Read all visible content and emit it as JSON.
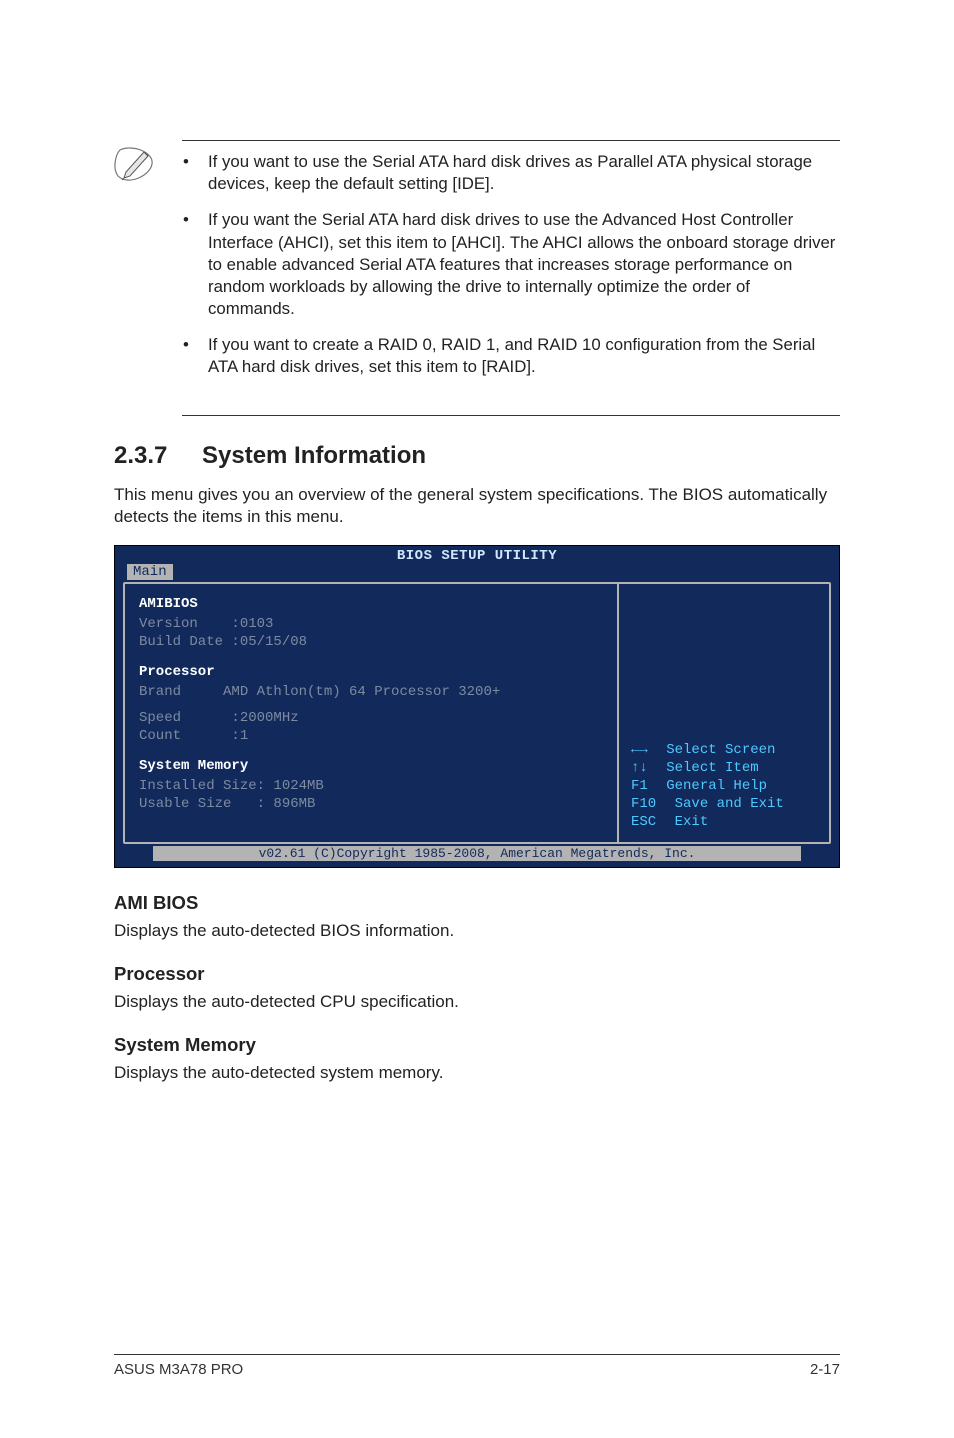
{
  "note": {
    "bullets": [
      "If you want to use the Serial ATA hard disk drives as Parallel ATA physical storage devices, keep the default setting [IDE].",
      "If you want the Serial ATA hard disk drives to use the Advanced Host Controller Interface (AHCI), set this item to [AHCI]. The AHCI allows the onboard storage driver to enable advanced Serial ATA features that increases storage performance on random workloads by allowing the drive to internally optimize the order of commands.",
      "If you want to create a RAID 0, RAID 1, and RAID 10 configuration from the Serial ATA hard disk drives, set this item to [RAID]."
    ]
  },
  "section": {
    "number": "2.3.7",
    "title": "System Information",
    "intro": "This menu gives you an overview of the general system specifications. The BIOS automatically detects the items in this menu."
  },
  "bios": {
    "title": "BIOS SETUP UTILITY",
    "tab": "Main",
    "left": {
      "h1": "AMIBIOS",
      "r1": "Version    :0103",
      "r2": "Build Date :05/15/08",
      "h2": "Processor",
      "r3": "Brand     AMD Athlon(tm) 64 Processor 3200+",
      "r4": "Speed      :2000MHz",
      "r5": "Count      :1",
      "h3": "System Memory",
      "r6": "Installed Size: 1024MB",
      "r7": "Usable Size   : 896MB"
    },
    "help": {
      "l1k": "←→",
      "l1v": " Select Screen",
      "l2k": "↑↓",
      "l2v": " Select Item",
      "l3k": "F1",
      "l3v": " General Help",
      "l4k": "F10",
      "l4v": " Save and Exit",
      "l5k": "ESC",
      "l5v": " Exit"
    },
    "footer": "v02.61 (C)Copyright 1985-2008, American Megatrends, Inc."
  },
  "subs": {
    "s1t": "AMI BIOS",
    "s1b": "Displays the auto-detected BIOS information.",
    "s2t": "Processor",
    "s2b": "Displays the auto-detected CPU specification.",
    "s3t": "System Memory",
    "s3b": "Displays the auto-detected system memory."
  },
  "footer": {
    "left": "ASUS M3A78 PRO",
    "right": "2-17"
  }
}
